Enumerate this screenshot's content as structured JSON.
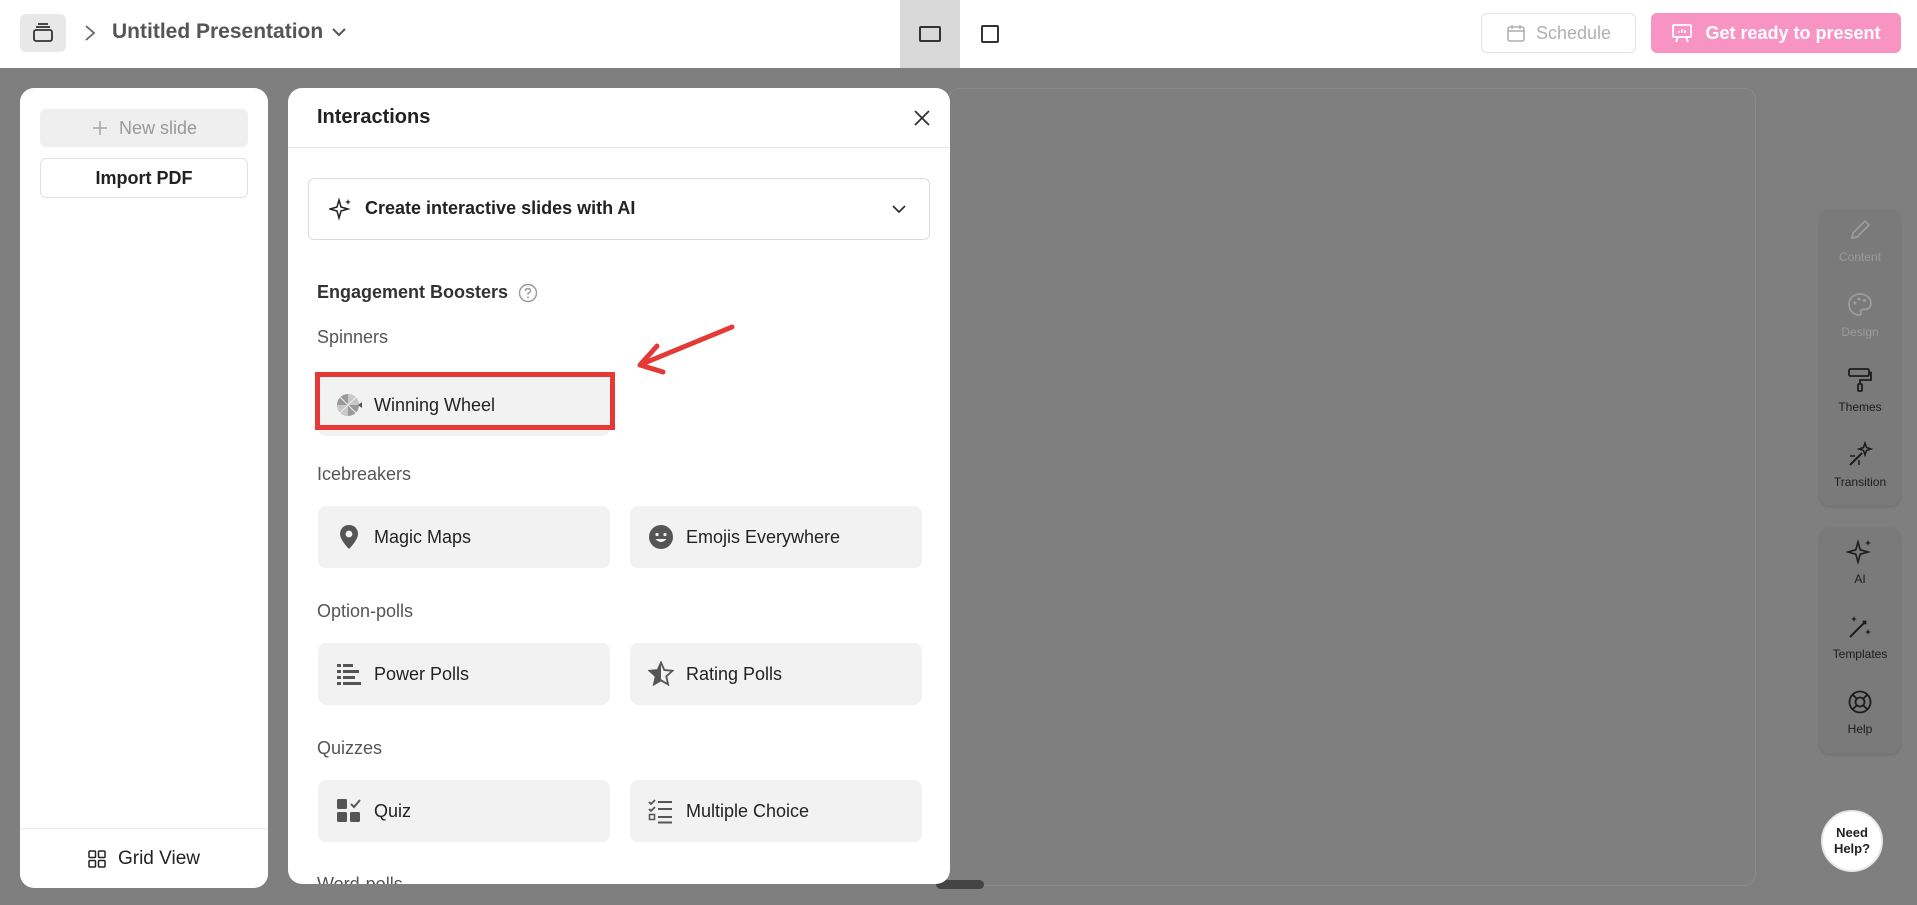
{
  "topbar": {
    "title": "Untitled Presentation",
    "schedule_label": "Schedule",
    "present_label": "Get ready to present"
  },
  "slides_panel": {
    "new_slide_label": "New slide",
    "import_label": "Import PDF",
    "grid_view_label": "Grid View"
  },
  "interactions": {
    "title": "Interactions",
    "ai_label": "Create interactive slides with AI",
    "section_title": "Engagement Boosters",
    "categories": [
      {
        "label": "Spinners",
        "items": [
          {
            "label": "Winning Wheel",
            "icon": "wheel-icon"
          }
        ]
      },
      {
        "label": "Icebreakers",
        "items": [
          {
            "label": "Magic Maps",
            "icon": "map-pin-icon"
          },
          {
            "label": "Emojis Everywhere",
            "icon": "emoji-icon"
          }
        ]
      },
      {
        "label": "Option-polls",
        "items": [
          {
            "label": "Power Polls",
            "icon": "bars-icon"
          },
          {
            "label": "Rating Polls",
            "icon": "star-icon"
          }
        ]
      },
      {
        "label": "Quizzes",
        "items": [
          {
            "label": "Quiz",
            "icon": "quiz-icon"
          },
          {
            "label": "Multiple Choice",
            "icon": "checklist-icon"
          }
        ]
      },
      {
        "label": "Word-polls"
      }
    ]
  },
  "rail": {
    "items": [
      {
        "label": "Content",
        "icon": "pencil-icon"
      },
      {
        "label": "Design",
        "icon": "palette-icon"
      },
      {
        "label": "Themes",
        "icon": "paint-roller-icon"
      },
      {
        "label": "Transition",
        "icon": "wand-icon"
      },
      {
        "label": "AI",
        "icon": "sparkle-icon"
      },
      {
        "label": "Templates",
        "icon": "magic-wand-icon"
      },
      {
        "label": "Help",
        "icon": "lifebuoy-icon"
      }
    ]
  },
  "need_help": {
    "line1": "Need",
    "line2": "Help?"
  },
  "colors": {
    "accent": "#f794c4",
    "highlight": "#e53935",
    "backdrop": "#7f7f7f"
  }
}
